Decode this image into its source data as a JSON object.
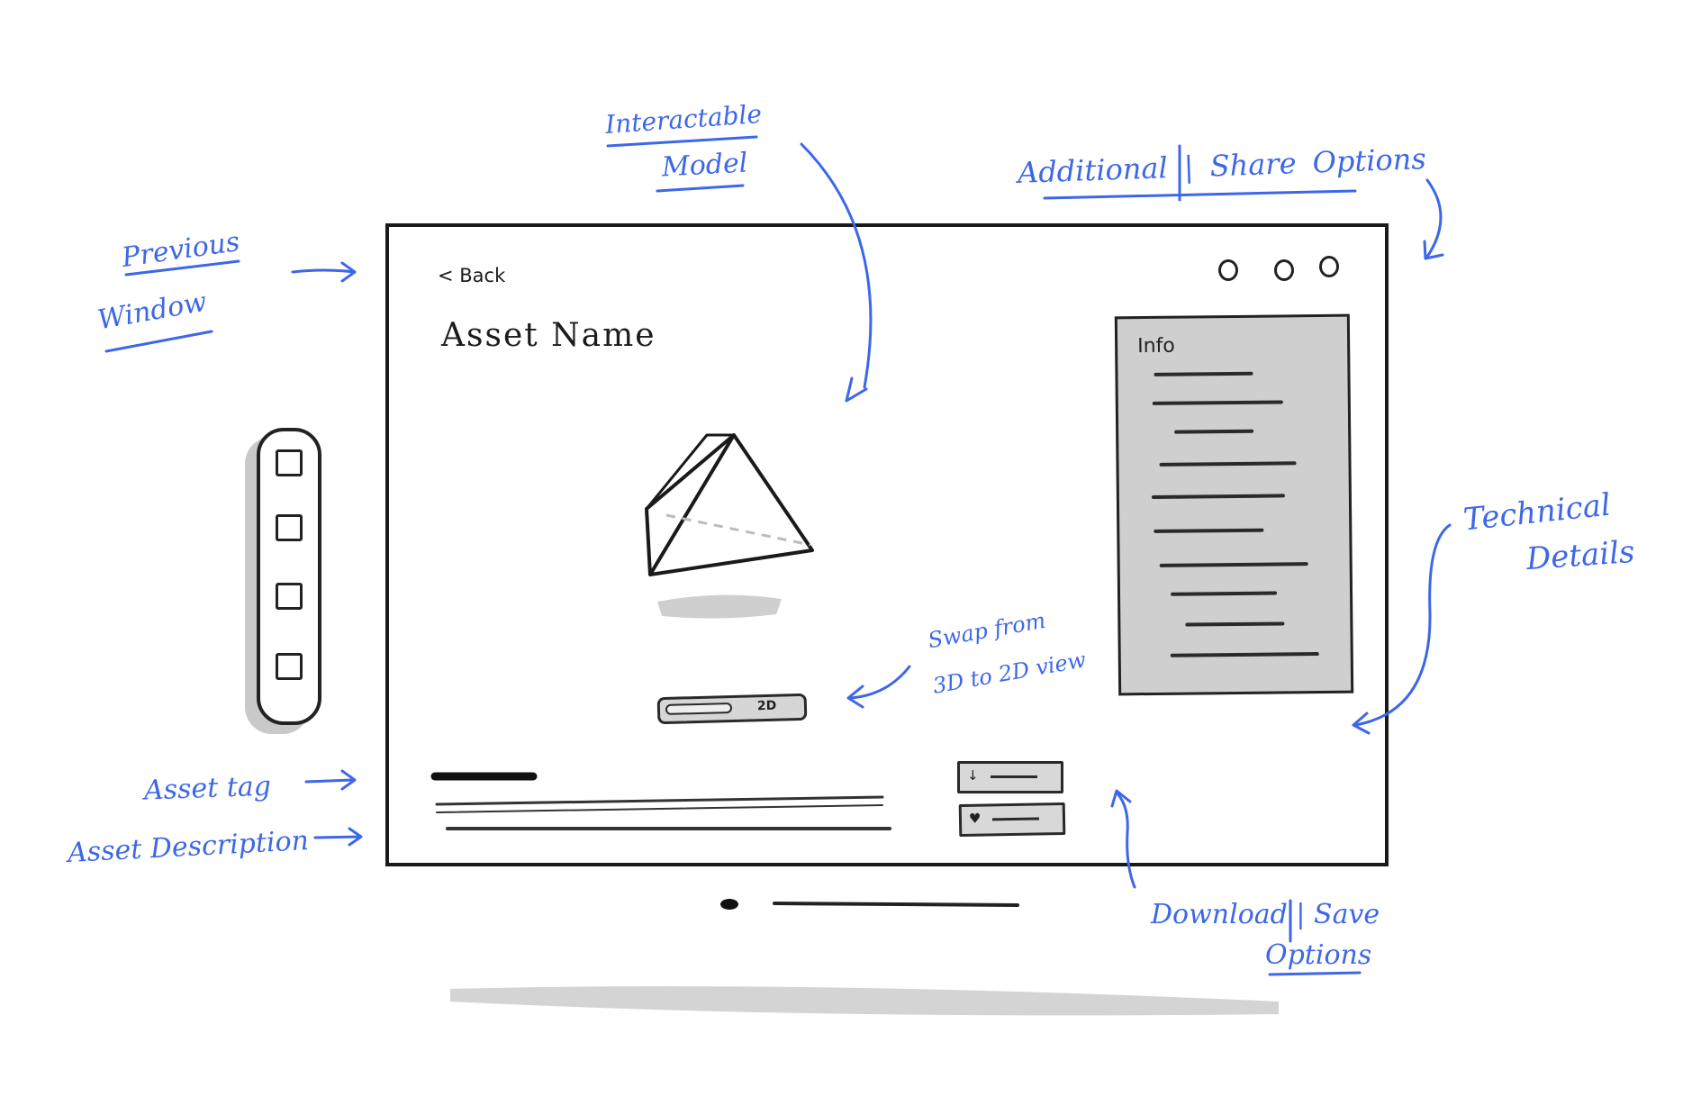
{
  "callouts": {
    "previous_window": [
      "Previous",
      "Window"
    ],
    "interactable_model": [
      "Interactable",
      "Model"
    ],
    "share_options": "Additional | Share Options",
    "technical_details": [
      "Technical",
      "Details"
    ],
    "swap_view": [
      "Swap from",
      "3D to 2D view"
    ],
    "asset_tag": "Asset tag",
    "asset_description": "Asset Description",
    "download_save": [
      "Download | Save",
      "Options"
    ]
  },
  "screen": {
    "back_label": "< Back",
    "asset_name": "Asset Name",
    "info_title": "Info",
    "toggle_label": "2D",
    "download_icon": "↓",
    "save_icon": "♥"
  },
  "colors": {
    "annotation": "#3d67e8",
    "ink": "#1c1c1c",
    "panel": "#cfcfcf"
  },
  "icons": [
    "menu-dot-icon",
    "download-icon",
    "heart-icon",
    "pyramid-model",
    "rail-square-icon"
  ]
}
